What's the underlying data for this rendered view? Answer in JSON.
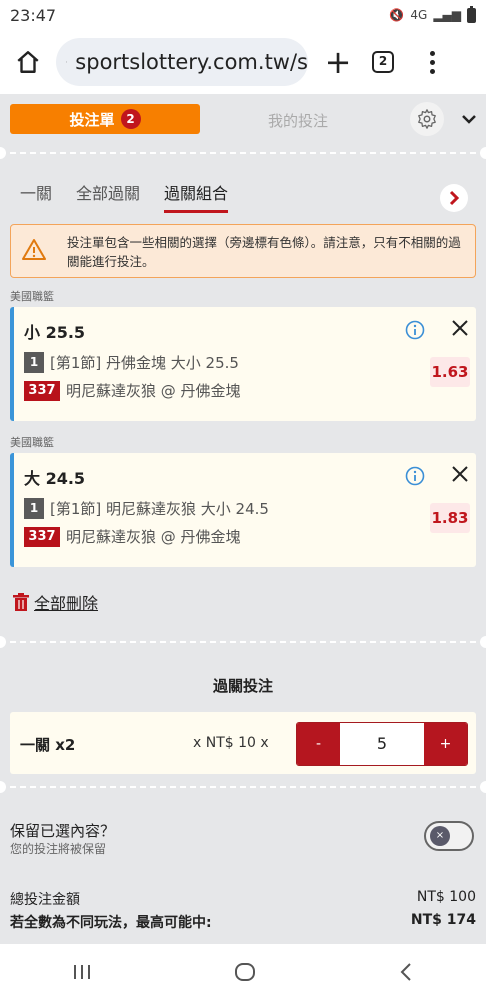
{
  "status": {
    "time": "23:47",
    "network": "4G"
  },
  "browser": {
    "url": "sportslottery.com.tw/s",
    "tab_count": "2"
  },
  "slip": {
    "tab_label": "投注單",
    "count": "2",
    "my_bets_label": "我的投注"
  },
  "sub_tabs": [
    {
      "label": "一關"
    },
    {
      "label": "全部過關"
    },
    {
      "label": "過關組合"
    }
  ],
  "warning": {
    "text": "投注單包含一些相關的選擇（旁邊標有色條）。請注意，只有不相關的過關能進行投注。"
  },
  "bets": [
    {
      "league": "美國職籃",
      "title": "小 25.5",
      "leg": "1",
      "market": "[第1節] 丹佛金塊 大小 25.5",
      "code": "337",
      "match": "明尼蘇達灰狼 @ 丹佛金塊",
      "odds": "1.63"
    },
    {
      "league": "美國職籃",
      "title": "大 24.5",
      "leg": "1",
      "market": "[第1節] 明尼蘇達灰狼 大小 24.5",
      "code": "337",
      "match": "明尼蘇達灰狼 @ 丹佛金塊",
      "odds": "1.83"
    }
  ],
  "delete_all_label": "全部刪除",
  "parlay": {
    "title": "過關投注",
    "label": "一關 x2",
    "unit": "x NT$ 10 x",
    "minus": "-",
    "plus": "+",
    "quantity": "5"
  },
  "keep": {
    "label": "保留已選內容？",
    "sub": "您的投注將被保留"
  },
  "totals": {
    "total_label": "總投注金額",
    "total_value": "NT$ 100",
    "max_label": "若全數為不同玩法，最高可能中:",
    "max_value": "NT$ 174"
  },
  "colors": {
    "accent": "#f77f00",
    "brand_red": "#b8121b",
    "selection_bar": "#3b95d9"
  }
}
